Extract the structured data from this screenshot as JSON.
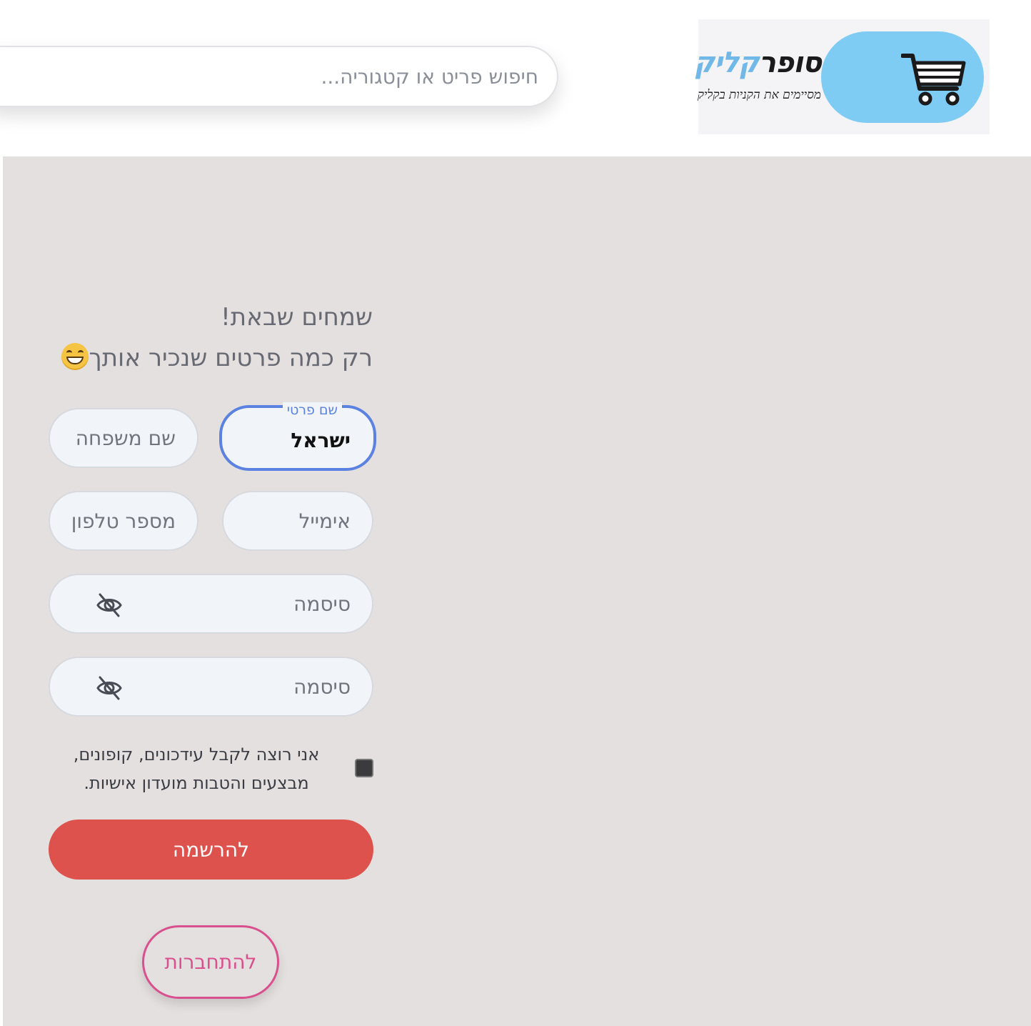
{
  "header": {
    "search_placeholder": "חיפוש פריט או קטגוריה...",
    "logo": {
      "word_dark": "סופר",
      "word_accent": "קליק",
      "tagline": "מסיימים את הקניות בקליק",
      "icon": "shopping-cart-icon",
      "pill_color": "#7ecbf4"
    }
  },
  "form": {
    "greeting_line1": "שמחים שבאת!",
    "greeting_line2": "רק כמה פרטים שנכיר אותך",
    "greeting_emoji": "grinning-face-emoji",
    "first_name": {
      "label": "שם פרטי",
      "value": "ישראל"
    },
    "last_name": {
      "placeholder": "שם משפחה"
    },
    "email": {
      "placeholder": "אימייל"
    },
    "phone": {
      "placeholder": "מספר טלפון"
    },
    "password": {
      "placeholder": "סיסמה",
      "icon": "eye-slash-icon"
    },
    "password_confirm": {
      "placeholder": "סיסמה",
      "icon": "eye-slash-icon"
    },
    "consent_text_line1": "אני רוצה לקבל עידכונים, קופונים,",
    "consent_text_line2": "מבצעים והטבות מועדון אישיות.",
    "register_label": "להרשמה",
    "login_label": "להתחברות"
  },
  "colors": {
    "focus": "#5b82e0",
    "register_button": "#de524d",
    "login_button": "#d9508e",
    "main_background": "#e4e0df"
  }
}
